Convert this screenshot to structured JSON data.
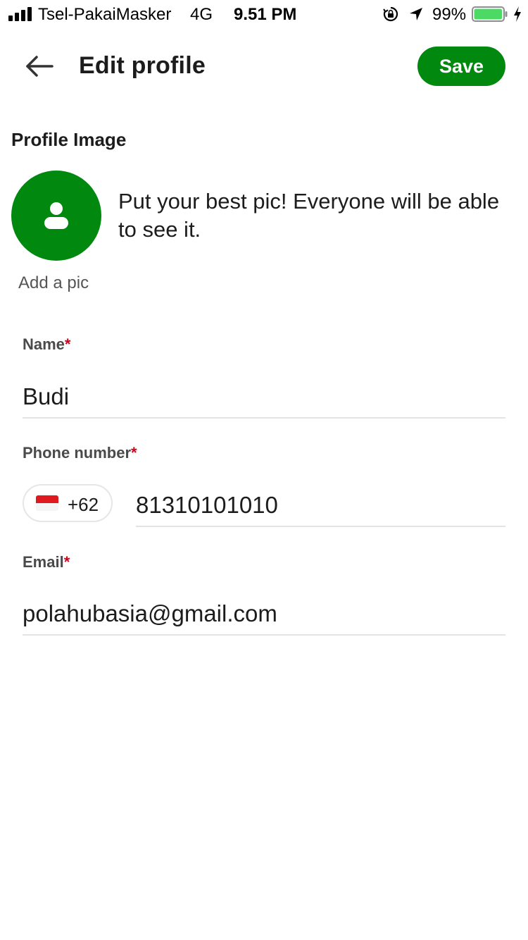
{
  "status_bar": {
    "carrier": "Tsel-PakaiMasker",
    "network": "4G",
    "time": "9.51 PM",
    "battery_percent": "99%",
    "battery_level": 0.99,
    "icons": [
      "signal-icon",
      "rotation-lock-icon",
      "location-arrow-icon",
      "battery-icon",
      "charging-bolt-icon"
    ]
  },
  "header": {
    "back_icon": "back-arrow-icon",
    "title": "Edit profile",
    "save_label": "Save"
  },
  "profile_image": {
    "section_title": "Profile Image",
    "caption": "Add a pic",
    "hint": "Put your best pic! Everyone will be able to see it.",
    "avatar_icon": "person-icon"
  },
  "form": {
    "name": {
      "label": "Name",
      "required_mark": "*",
      "value": "Budi"
    },
    "phone": {
      "label": "Phone number",
      "required_mark": "*",
      "country_flag": "indonesia-flag-icon",
      "dial_code": "+62",
      "value": "81310101010"
    },
    "email": {
      "label": "Email",
      "required_mark": "*",
      "value": "polahubasia@gmail.com"
    }
  },
  "colors": {
    "primary_green": "#00880f",
    "required_red": "#d0021b",
    "battery_green": "#4cd964",
    "divider": "#e3e3e3"
  }
}
